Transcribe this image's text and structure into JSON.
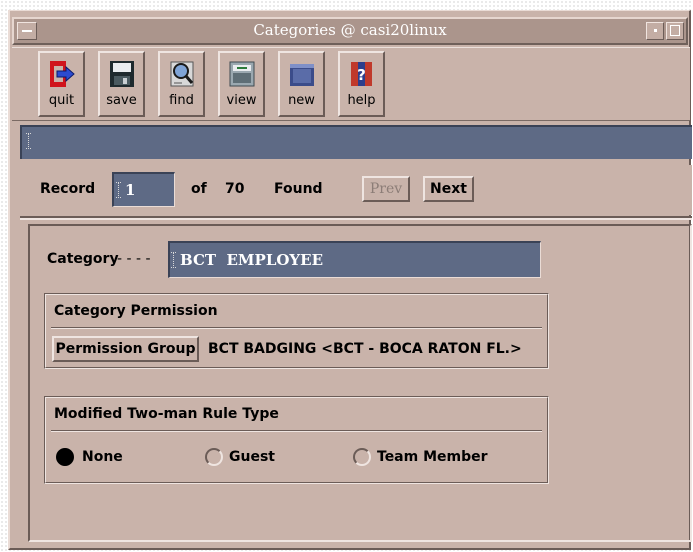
{
  "window": {
    "title": "Categories @ casi20linux"
  },
  "toolbar": {
    "quit_label": "quit",
    "save_label": "save",
    "find_label": "find",
    "view_label": "view",
    "new_label": "new",
    "help_label": "help"
  },
  "message": {
    "value": ""
  },
  "record": {
    "label": "Record",
    "value": "1",
    "of_label": "of",
    "total": "70",
    "found_label": "Found",
    "prev_label": "Prev",
    "next_label": "Next"
  },
  "category": {
    "label": "Category",
    "dashes": "- - - -",
    "value": "BCT  EMPLOYEE"
  },
  "permission": {
    "section_title": "Category Permission",
    "button_label": "Permission Group",
    "value": "BCT BADGING <BCT - BOCA RATON FL.>"
  },
  "two_man": {
    "section_title": "Modified Two-man Rule Type",
    "options": [
      "None",
      "Guest",
      "Team Member"
    ],
    "selected": "None"
  },
  "colors": {
    "background": "#c9b3aa",
    "field": "#5e6a85",
    "titlebar": "#ab958c"
  }
}
